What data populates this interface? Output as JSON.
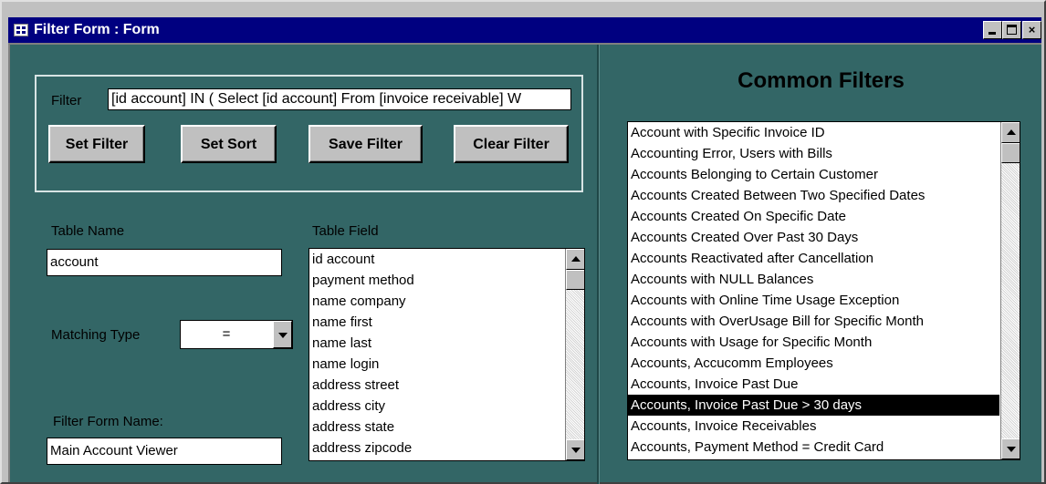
{
  "window": {
    "title": "Filter Form : Form",
    "min_glyph": "",
    "max_glyph": "",
    "close_glyph": "×"
  },
  "filter": {
    "label": "Filter",
    "value": "[id account] IN ( Select [id account] From [invoice receivable] W"
  },
  "buttons": {
    "set_filter": "Set Filter",
    "set_sort": "Set Sort",
    "save_filter": "Save Filter",
    "clear_filter": "Clear Filter"
  },
  "table_name": {
    "label": "Table Name",
    "value": "account"
  },
  "table_field": {
    "label": "Table Field",
    "items": [
      "id account",
      "payment method",
      "name company",
      "name first",
      "name last",
      "name login",
      "address street",
      "address city",
      "address state",
      "address zipcode"
    ]
  },
  "matching_type": {
    "label": "Matching Type",
    "value": "="
  },
  "filter_form_name": {
    "label": "Filter Form Name:",
    "value": "Main Account Viewer"
  },
  "common_filters": {
    "title": "Common Filters",
    "selected_index": 13,
    "items": [
      "Account with Specific Invoice ID",
      "Accounting Error, Users with Bills",
      "Accounts Belonging to Certain Customer",
      "Accounts Created Between Two Specified Dates",
      "Accounts Created On Specific Date",
      "Accounts Created Over Past 30 Days",
      "Accounts Reactivated after Cancellation",
      "Accounts with NULL Balances",
      "Accounts with Online Time Usage Exception",
      "Accounts with OverUsage Bill for Specific Month",
      "Accounts with Usage for Specific Month",
      "Accounts, Accucomm Employees",
      "Accounts, Invoice Past Due",
      "Accounts, Invoice Past Due > 30 days",
      "Accounts, Invoice Receivables",
      "Accounts, Payment Method =  Credit Card"
    ]
  },
  "colors": {
    "form_background": "#336666",
    "title_bar": "#000080",
    "selection": "#000000"
  }
}
